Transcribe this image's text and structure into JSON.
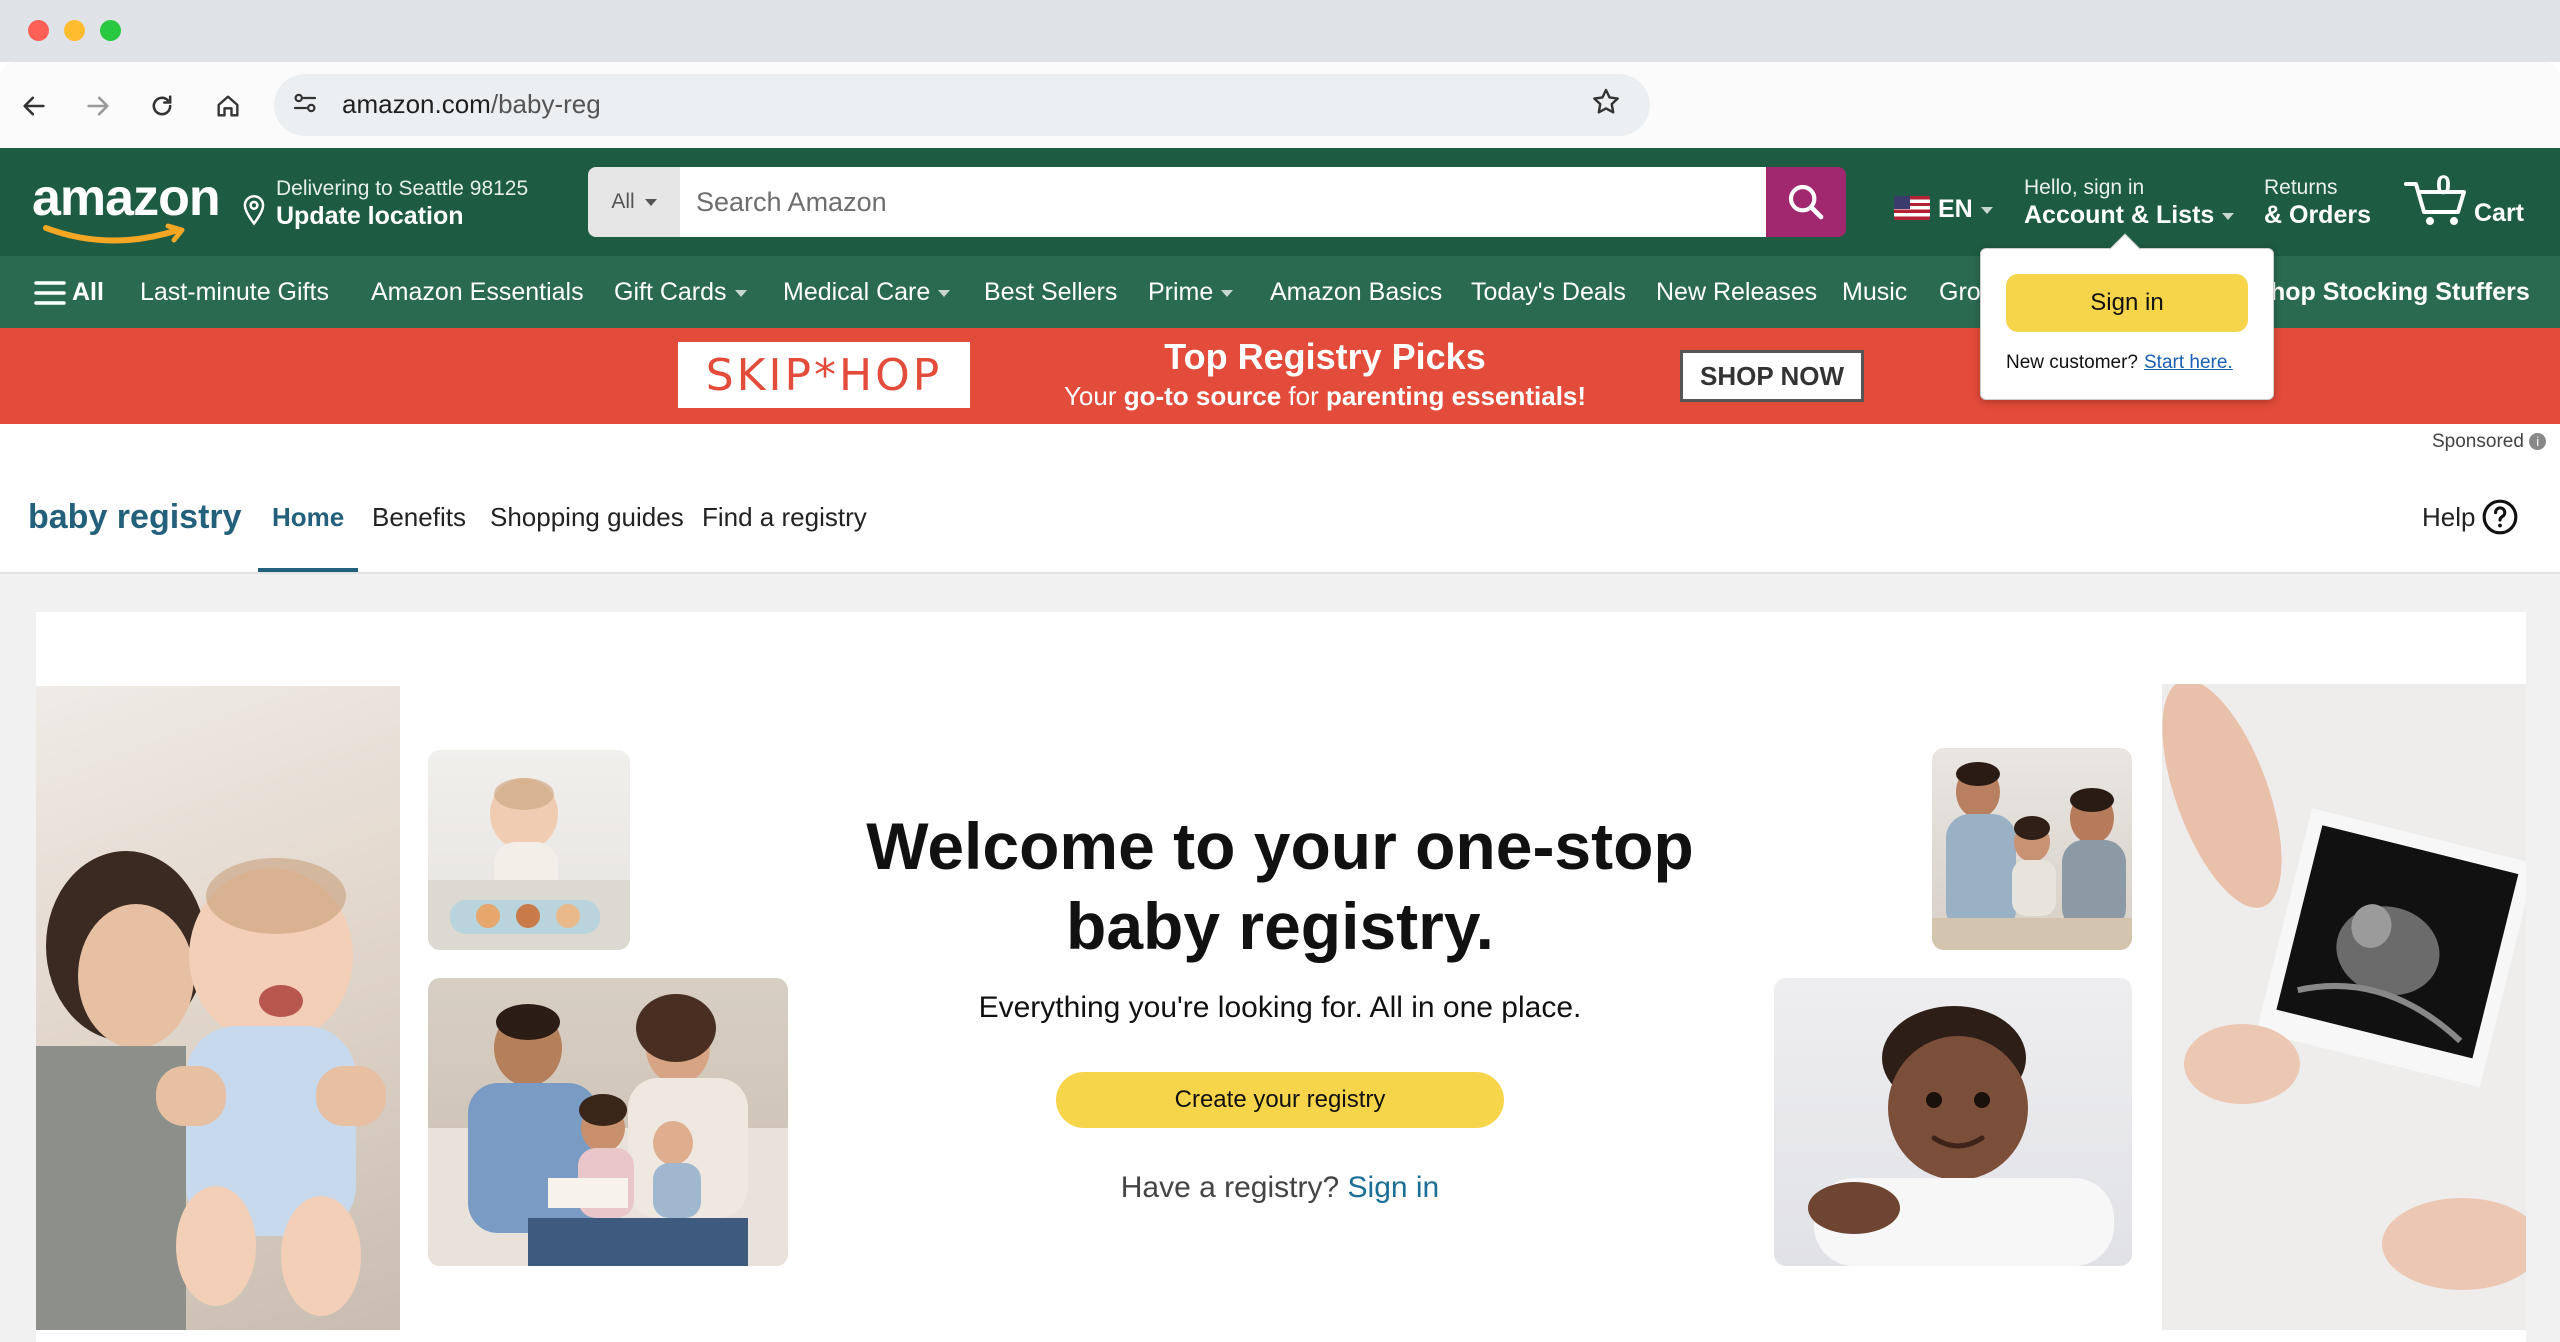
{
  "browser": {
    "url_host": "amazon.com",
    "url_path": "/baby-reg"
  },
  "header": {
    "logo": "amazon",
    "delivering_line": "Delivering to Seattle 98125",
    "update_location": "Update location",
    "search_category": "All",
    "search_placeholder": "Search Amazon",
    "language": "EN",
    "hello_signin": "Hello, sign in",
    "account_lists": "Account & Lists",
    "returns": "Returns",
    "orders": "& Orders",
    "cart_count": "0",
    "cart_label": "Cart"
  },
  "subnav": {
    "all": "All",
    "items": [
      "Last-minute Gifts",
      "Amazon Essentials",
      "Gift Cards",
      "Medical Care",
      "Best Sellers",
      "Prime",
      "Amazon Basics",
      "Today's Deals",
      "New Releases",
      "Music",
      "Gro",
      "hop Stocking Stuffers"
    ]
  },
  "banner": {
    "brand": "SKIP*HOP",
    "title": "Top Registry Picks",
    "subtitle_pre": "Your ",
    "subtitle_b1": "go-to source",
    "subtitle_mid": " for ",
    "subtitle_b2": "parenting essentials!",
    "cta": "SHOP NOW",
    "sponsored": "Sponsored"
  },
  "registry_nav": {
    "brand": "baby registry",
    "tabs": [
      "Home",
      "Benefits",
      "Shopping guides",
      "Find a registry"
    ],
    "help": "Help"
  },
  "hero": {
    "title": "Welcome to your one-stop baby registry.",
    "tagline": "Everything you're looking for. All in one place.",
    "create_button": "Create your registry",
    "have_registry": "Have a registry?",
    "sign_in_link": "Sign in"
  },
  "signin_popover": {
    "button": "Sign in",
    "new_customer": "New customer?",
    "start_here": "Start here."
  },
  "colors": {
    "header_green": "#1d5b43",
    "subnav_green": "#2a6a51",
    "search_button": "#a1286f",
    "banner_red": "#e34b3a",
    "accent_yellow": "#f7d54a",
    "registry_teal": "#23607b"
  }
}
